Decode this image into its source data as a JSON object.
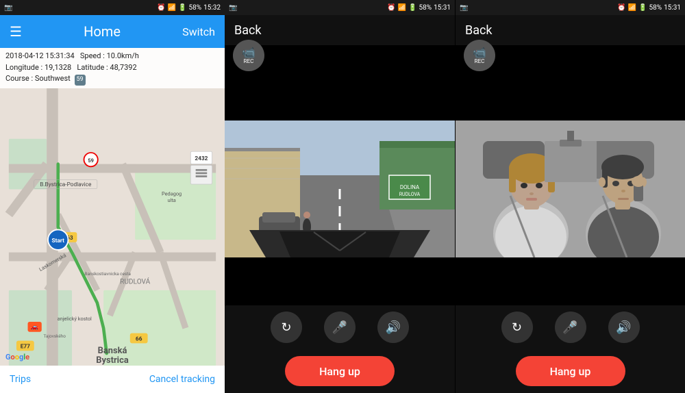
{
  "panel1": {
    "statusBar": {
      "leftIcon": "📷",
      "time": "15:32",
      "battery": "58%"
    },
    "header": {
      "title": "Home",
      "switchLabel": "Switch"
    },
    "infoBar": {
      "dateTime": "2018-04-12  15:31:34",
      "speed": "Speed : 10.0km/h",
      "longitude": "Longitude : 19,1328",
      "latitude": "Latitude : 48,7392",
      "course": "Course : Southwest",
      "courseBadge": "59"
    },
    "map": {
      "speedBadge": "2432"
    },
    "footer": {
      "trips": "Trips",
      "cancel": "Cancel tracking"
    }
  },
  "panel2": {
    "statusBar": {
      "leftIcon": "📷",
      "time": "15:31",
      "battery": "58%"
    },
    "header": {
      "back": "Back"
    },
    "rec": "REC",
    "hangup": "Hang up"
  },
  "panel3": {
    "statusBar": {
      "leftIcon": "📷",
      "time": "15:31",
      "battery": "58%"
    },
    "header": {
      "back": "Back"
    },
    "rec": "REC",
    "hangup": "Hang up"
  },
  "icons": {
    "menu": "☰",
    "rec_cam": "📹",
    "refresh": "↻",
    "mute": "🎤",
    "speaker": "🔊"
  }
}
